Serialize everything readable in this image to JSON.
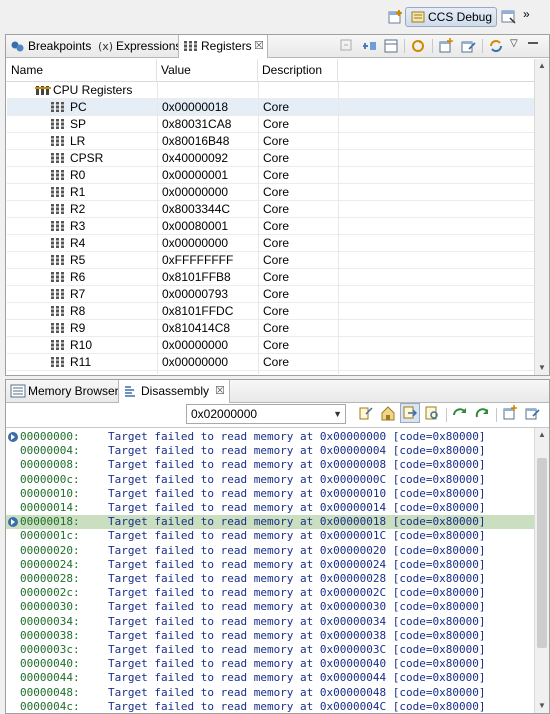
{
  "perspective": {
    "label": "CCS Debug"
  },
  "registers_view": {
    "tabs": [
      {
        "label": "Breakpoints"
      },
      {
        "label": "Expressions"
      },
      {
        "label": "Registers",
        "close": "☒"
      }
    ],
    "columns": {
      "name": "Name",
      "value": "Value",
      "description": "Description"
    },
    "group": "CPU Registers",
    "registers": [
      {
        "name": "PC",
        "value": "0x00000018",
        "description": "Core"
      },
      {
        "name": "SP",
        "value": "0x80031CA8",
        "description": "Core"
      },
      {
        "name": "LR",
        "value": "0x80016B48",
        "description": "Core"
      },
      {
        "name": "CPSR",
        "value": "0x40000092",
        "description": "Core"
      },
      {
        "name": "R0",
        "value": "0x00000001",
        "description": "Core"
      },
      {
        "name": "R1",
        "value": "0x00000000",
        "description": "Core"
      },
      {
        "name": "R2",
        "value": "0x8003344C",
        "description": "Core"
      },
      {
        "name": "R3",
        "value": "0x00080001",
        "description": "Core"
      },
      {
        "name": "R4",
        "value": "0x00000000",
        "description": "Core"
      },
      {
        "name": "R5",
        "value": "0xFFFFFFFF",
        "description": "Core"
      },
      {
        "name": "R6",
        "value": "0x8101FFB8",
        "description": "Core"
      },
      {
        "name": "R7",
        "value": "0x00000793",
        "description": "Core"
      },
      {
        "name": "R8",
        "value": "0x8101FFDC",
        "description": "Core"
      },
      {
        "name": "R9",
        "value": "0x810414C8",
        "description": "Core"
      },
      {
        "name": "R10",
        "value": "0x00000000",
        "description": "Core"
      },
      {
        "name": "R11",
        "value": "0x00000000",
        "description": "Core"
      }
    ]
  },
  "disassembly_view": {
    "tabs": [
      {
        "label": "Memory Browser"
      },
      {
        "label": "Disassembly",
        "close": "☒"
      }
    ],
    "address": "0x02000000",
    "current_line_index": 6,
    "lines": [
      {
        "addr": "00000000:",
        "text": "Target failed to read memory at 0x00000000 [code=0x80000]"
      },
      {
        "addr": "00000004:",
        "text": "Target failed to read memory at 0x00000004 [code=0x80000]"
      },
      {
        "addr": "00000008:",
        "text": "Target failed to read memory at 0x00000008 [code=0x80000]"
      },
      {
        "addr": "0000000c:",
        "text": "Target failed to read memory at 0x0000000C [code=0x80000]"
      },
      {
        "addr": "00000010:",
        "text": "Target failed to read memory at 0x00000010 [code=0x80000]"
      },
      {
        "addr": "00000014:",
        "text": "Target failed to read memory at 0x00000014 [code=0x80000]"
      },
      {
        "addr": "00000018:",
        "text": "Target failed to read memory at 0x00000018 [code=0x80000]"
      },
      {
        "addr": "0000001c:",
        "text": "Target failed to read memory at 0x0000001C [code=0x80000]"
      },
      {
        "addr": "00000020:",
        "text": "Target failed to read memory at 0x00000020 [code=0x80000]"
      },
      {
        "addr": "00000024:",
        "text": "Target failed to read memory at 0x00000024 [code=0x80000]"
      },
      {
        "addr": "00000028:",
        "text": "Target failed to read memory at 0x00000028 [code=0x80000]"
      },
      {
        "addr": "0000002c:",
        "text": "Target failed to read memory at 0x0000002C [code=0x80000]"
      },
      {
        "addr": "00000030:",
        "text": "Target failed to read memory at 0x00000030 [code=0x80000]"
      },
      {
        "addr": "00000034:",
        "text": "Target failed to read memory at 0x00000034 [code=0x80000]"
      },
      {
        "addr": "00000038:",
        "text": "Target failed to read memory at 0x00000038 [code=0x80000]"
      },
      {
        "addr": "0000003c:",
        "text": "Target failed to read memory at 0x0000003C [code=0x80000]"
      },
      {
        "addr": "00000040:",
        "text": "Target failed to read memory at 0x00000040 [code=0x80000]"
      },
      {
        "addr": "00000044:",
        "text": "Target failed to read memory at 0x00000044 [code=0x80000]"
      },
      {
        "addr": "00000048:",
        "text": "Target failed to read memory at 0x00000048 [code=0x80000]"
      },
      {
        "addr": "0000004c:",
        "text": "Target failed to read memory at 0x0000004C [code=0x80000]"
      }
    ]
  },
  "colors": {
    "address": "#1f6f2b",
    "message": "#1a2e8a",
    "current_line": "#c9dfbf",
    "selected_row": "#e5edf7"
  }
}
